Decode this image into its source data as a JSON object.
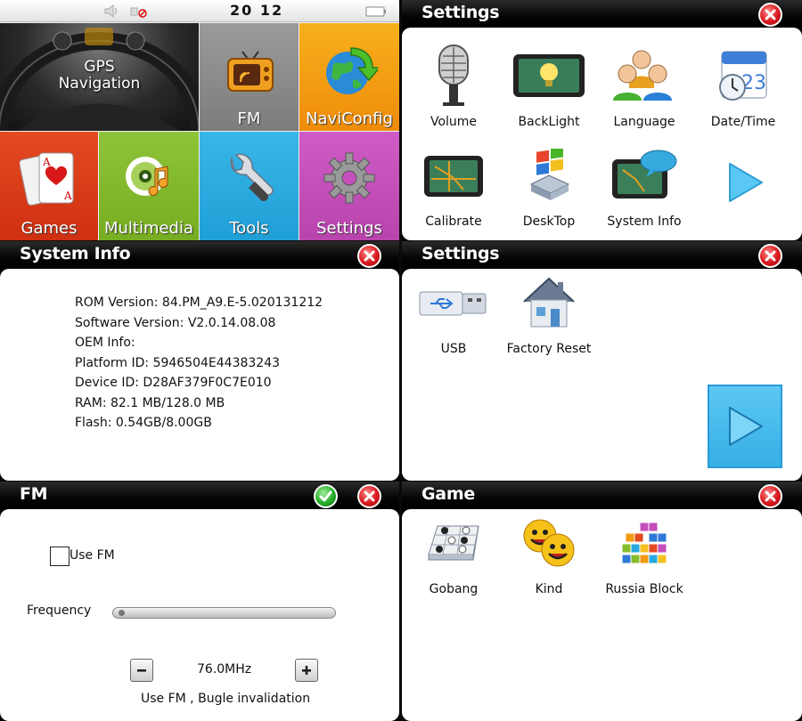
{
  "status_bar": {
    "time": "20 12"
  },
  "home": {
    "tiles": {
      "gps": "GPS\nNavigation",
      "fm": "FM",
      "naviconfig": "NaviConfig",
      "games": "Games",
      "multimedia": "Multimedia",
      "tools": "Tools",
      "settings": "Settings"
    }
  },
  "settings_main": {
    "title": "Settings",
    "items": [
      "Volume",
      "BackLight",
      "Language",
      "Date/Time",
      "Calibrate",
      "DeskTop",
      "System Info"
    ]
  },
  "system_info": {
    "title": "System Info",
    "lines": [
      "ROM Version: 84.PM_A9.E-5.020131212",
      "Software Version: V2.0.14.08.08",
      "OEM Info:",
      "Platform ID: 5946504E44383243",
      "Device ID: D28AF379F0C7E010",
      "RAM: 82.1 MB/128.0 MB",
      "Flash: 0.54GB/8.00GB"
    ]
  },
  "settings_page2": {
    "title": "Settings",
    "items": [
      "USB",
      "Factory Reset"
    ]
  },
  "fm": {
    "title": "FM",
    "use_fm_label": "Use FM",
    "frequency_label": "Frequency",
    "frequency_value": "76.0MHz",
    "status": "Use FM , Bugle invalidation",
    "use_fm_checked": false
  },
  "game": {
    "title": "Game",
    "items": [
      "Gobang",
      "Kind",
      "Russia Block"
    ]
  },
  "colors": {
    "tile_orange": "#f29a10",
    "tile_red": "#dd3a1a",
    "tile_green": "#86bc2c",
    "tile_cyan": "#27a9df",
    "tile_purple": "#c44fbb",
    "tile_gray": "#8c8c8c",
    "close_red": "#d8181e",
    "ok_green": "#26ac2a"
  },
  "icons": {
    "close": "close-icon",
    "ok": "check-icon",
    "next": "play-arrow-icon",
    "volume": "microphone-icon",
    "backlight": "lightbulb-icon",
    "language": "people-icon",
    "datetime": "calendar-clock-icon",
    "calibrate": "calibrate-icon",
    "desktop": "desktop-windows-icon",
    "system_info": "info-bubble-icon",
    "usb": "usb-drive-icon",
    "factory_reset": "house-icon",
    "gobang": "gobang-board-icon",
    "kind": "smiley-faces-icon",
    "russia_block": "tetris-blocks-icon"
  }
}
